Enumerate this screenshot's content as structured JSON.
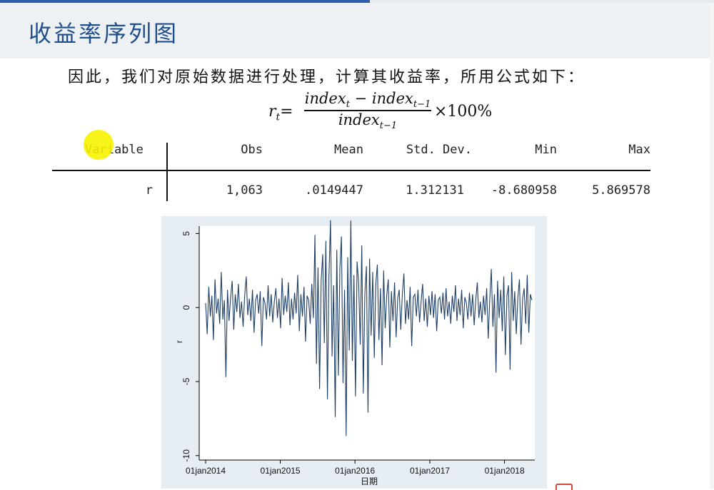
{
  "header": {
    "title": "收益率序列图"
  },
  "body": {
    "intro": "因此，我们对原始数据进行处理，计算其收益率，所用公式如下："
  },
  "formula": {
    "lhs_var": "r",
    "lhs_sub": "t",
    "eq": "=",
    "num_a": "index",
    "num_a_sub": "t",
    "num_minus": " − ",
    "num_b": "index",
    "num_b_sub": "t−1",
    "den": "index",
    "den_sub": "t−1",
    "times": "×100%"
  },
  "stats_table": {
    "headers": [
      "Variable",
      "Obs",
      "Mean",
      "Std. Dev.",
      "Min",
      "Max"
    ],
    "row": [
      "r",
      "1,063",
      ".0149447",
      "1.312131",
      "-8.680958",
      "5.869578"
    ]
  },
  "colors": {
    "series": "#1f3f66",
    "accent": "#1f4e8c",
    "highlight": "#f7f200",
    "plot_bg": "#e6eef3"
  },
  "chart_data": {
    "type": "line",
    "xlabel": "日期",
    "ylabel": "r",
    "x_ticks": [
      "01jan2014",
      "01jan2015",
      "01jan2016",
      "01jan2017",
      "01jan2018"
    ],
    "y_ticks": [
      "-10",
      "-5",
      "0",
      "5"
    ],
    "ylim": [
      -10,
      5
    ],
    "xlim": [
      "2014-01-01",
      "2018-05-15"
    ],
    "n_obs": 1063,
    "y_min": -8.680958,
    "y_max": 5.869578,
    "grid": false,
    "series": [
      {
        "values": [
          0.3,
          -1.8,
          1.4,
          -0.6,
          0.8,
          -2.2,
          1.9,
          -0.4,
          0.6,
          -1.1,
          2.4,
          -0.8,
          0.5,
          -4.7,
          1.2,
          -0.9,
          0.7,
          1.8,
          -1.5,
          0.9,
          -0.3,
          1.6,
          -0.7,
          0.4,
          -1.3,
          0.8,
          2.1,
          -0.5,
          0.6,
          -0.9,
          1.2,
          -1.7,
          0.5,
          0.9,
          -0.4,
          1.1,
          -2.6,
          0.7,
          0.3,
          -0.8,
          1.5,
          -0.6,
          0.9,
          -1.0,
          0.4,
          1.3,
          -0.7,
          0.6,
          -1.4,
          2.0,
          -0.5,
          0.8,
          -0.3,
          1.7,
          -1.2,
          0.6,
          -0.8,
          1.0,
          -0.4,
          2.2,
          -1.6,
          0.9,
          -0.6,
          1.4,
          -2.3,
          0.8,
          0.5,
          -1.1,
          1.6,
          -0.7,
          4.9,
          -3.8,
          2.7,
          -5.5,
          1.8,
          3.6,
          -2.4,
          4.5,
          -6.2,
          2.1,
          5.9,
          -3.3,
          1.5,
          -7.4,
          3.9,
          -4.6,
          2.6,
          4.8,
          -5.1,
          1.2,
          -8.68,
          3.4,
          -2.9,
          5.87,
          -3.6,
          2.2,
          -6.0,
          3.1,
          1.7,
          -2.5,
          4.2,
          -5.8,
          0.9,
          2.8,
          -7.1,
          3.3,
          -1.9,
          2.4,
          -3.4,
          1.6,
          2.9,
          -2.2,
          1.3,
          -3.9,
          2.5,
          -1.4,
          0.8,
          1.9,
          -2.7,
          1.1,
          -0.9,
          1.7,
          -2.0,
          0.6,
          1.2,
          -1.5,
          0.9,
          2.3,
          -1.1,
          0.5,
          -0.8,
          1.4,
          -2.6,
          0.7,
          0.9,
          -0.6,
          1.2,
          -1.0,
          0.4,
          1.6,
          -0.9,
          0.6,
          -1.3,
          0.8,
          -0.5,
          1.1,
          -0.7,
          0.9,
          -1.6,
          0.5,
          0.7,
          -0.4,
          1.0,
          -0.8,
          1.3,
          -0.6,
          0.4,
          -1.1,
          0.8,
          -0.3,
          1.5,
          -0.9,
          0.6,
          -0.5,
          1.2,
          -1.4,
          0.7,
          0.3,
          -0.8,
          1.0,
          -0.6,
          0.9,
          -1.2,
          0.5,
          1.7,
          -0.7,
          0.4,
          -1.0,
          0.8,
          -0.5,
          1.3,
          -2.1,
          0.6,
          2.6,
          -1.3,
          0.9,
          -4.4,
          1.8,
          -0.7,
          1.2,
          -1.6,
          2.1,
          -3.2,
          0.8,
          1.5,
          -4.2,
          2.4,
          -0.9,
          1.1,
          -1.8,
          0.7,
          1.9,
          -2.5,
          0.6,
          1.3,
          -1.1,
          2.2,
          -1.7,
          0.9,
          0.5
        ]
      }
    ]
  }
}
